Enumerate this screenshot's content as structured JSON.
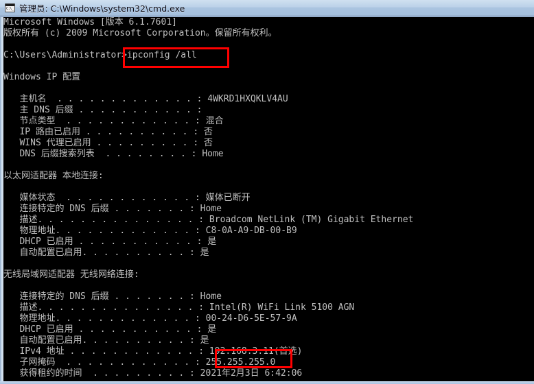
{
  "window": {
    "icon": "cmd-window-icon",
    "title": "管理员: C:\\Windows\\system32\\cmd.exe"
  },
  "console": {
    "lines": [
      "Microsoft Windows [版本 6.1.7601]",
      "版权所有 (c) 2009 Microsoft Corporation。保留所有权利。",
      "",
      "C:\\Users\\Administrator>ipconfig /all",
      "",
      "Windows IP 配置",
      "",
      "   主机名  . . . . . . . . . . . . . : 4WKRD1HXQKLV4AU",
      "   主 DNS 后缀 . . . . . . . . . . . :",
      "   节点类型  . . . . . . . . . . . . : 混合",
      "   IP 路由已启用 . . . . . . . . . . : 否",
      "   WINS 代理已启用 . . . . . . . . . : 否",
      "   DNS 后缀搜索列表  . . . . . . . . : Home",
      "",
      "以太网适配器 本地连接:",
      "",
      "   媒体状态  . . . . . . . . . . . . : 媒体已断开",
      "   连接特定的 DNS 后缀 . . . . . . . : Home",
      "   描述. . . . . . . . . . . . . . . : Broadcom NetLink (TM) Gigabit Ethernet",
      "   物理地址. . . . . . . . . . . . . : C8-0A-A9-DB-00-B9",
      "   DHCP 已启用 . . . . . . . . . . . : 是",
      "   自动配置已启用. . . . . . . . . . : 是",
      "",
      "无线局域网适配器 无线网络连接:",
      "",
      "   连接特定的 DNS 后缀 . . . . . . . : Home",
      "   描述. . . . . . . . . . . . . . . : Intel(R) WiFi Link 5100 AGN",
      "   物理地址. . . . . . . . . . . . . : 00-24-D6-5E-57-9A",
      "   DHCP 已启用 . . . . . . . . . . . : 是",
      "   自动配置已启用. . . . . . . . . . : 是",
      "   IPv4 地址 . . . . . . . . . . . . : 192.168.3.11(首选)",
      "   子网掩码  . . . . . . . . . . . . : 255.255.255.0",
      "   获得租约的时间  . . . . . . . . . : 2021年2月3日 6:42:06"
    ]
  },
  "annotations": {
    "color": "#ff0000",
    "boxes": [
      {
        "id": "redbox-cmd",
        "target": "ipconfig /all"
      },
      {
        "id": "redbox-ip",
        "target": "192.168.3.11"
      }
    ]
  }
}
